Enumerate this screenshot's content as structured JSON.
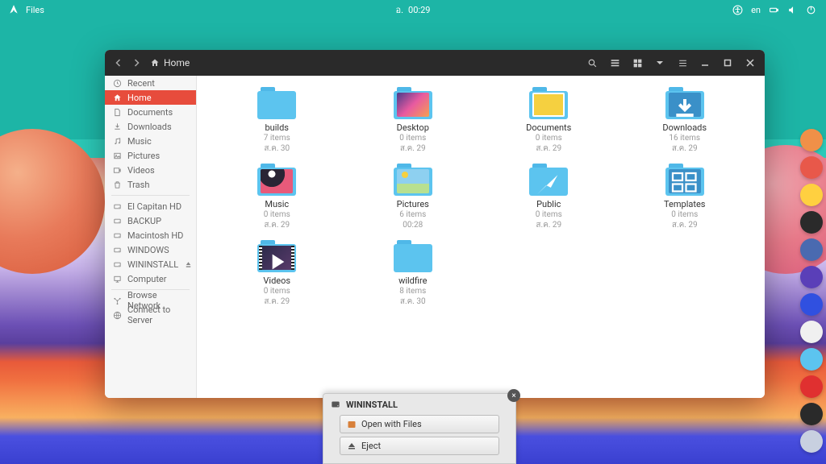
{
  "panel": {
    "app_name": "Files",
    "time_prefix": "อ.",
    "time": "00:29",
    "lang": "en"
  },
  "titlebar": {
    "location_label": "Home"
  },
  "sidebar": {
    "items": [
      {
        "label": "Recent",
        "icon": "clock",
        "active": false
      },
      {
        "label": "Home",
        "icon": "home",
        "active": true
      },
      {
        "label": "Documents",
        "icon": "doc",
        "active": false
      },
      {
        "label": "Downloads",
        "icon": "download",
        "active": false
      },
      {
        "label": "Music",
        "icon": "music",
        "active": false
      },
      {
        "label": "Pictures",
        "icon": "picture",
        "active": false
      },
      {
        "label": "Videos",
        "icon": "video",
        "active": false
      },
      {
        "label": "Trash",
        "icon": "trash",
        "active": false
      }
    ],
    "devices": [
      {
        "label": "El Capitan HD",
        "icon": "hdd"
      },
      {
        "label": "BACKUP",
        "icon": "hdd"
      },
      {
        "label": "Macintosh HD",
        "icon": "hdd"
      },
      {
        "label": "WINDOWS",
        "icon": "hdd"
      },
      {
        "label": "WININSTALL",
        "icon": "hdd",
        "eject": true
      },
      {
        "label": "Computer",
        "icon": "computer"
      }
    ],
    "network": [
      {
        "label": "Browse Network",
        "icon": "net"
      },
      {
        "label": "Connect to Server",
        "icon": "globe"
      }
    ]
  },
  "folders": [
    {
      "name": "builds",
      "items": "7 items",
      "date": "ส.ค. 30",
      "type": "plain"
    },
    {
      "name": "Desktop",
      "items": "0 items",
      "date": "ส.ค. 29",
      "type": "desktop"
    },
    {
      "name": "Documents",
      "items": "0 items",
      "date": "ส.ค. 29",
      "type": "documents"
    },
    {
      "name": "Downloads",
      "items": "16 items",
      "date": "ส.ค. 29",
      "type": "downloads"
    },
    {
      "name": "Music",
      "items": "0 items",
      "date": "ส.ค. 29",
      "type": "music"
    },
    {
      "name": "Pictures",
      "items": "6 items",
      "date": "00:28",
      "type": "pictures"
    },
    {
      "name": "Public",
      "items": "0 items",
      "date": "ส.ค. 29",
      "type": "public"
    },
    {
      "name": "Templates",
      "items": "0 items",
      "date": "ส.ค. 29",
      "type": "templates"
    },
    {
      "name": "Videos",
      "items": "0 items",
      "date": "ส.ค. 29",
      "type": "videos"
    },
    {
      "name": "wildfire",
      "items": "8 items",
      "date": "ส.ค. 30",
      "type": "plain"
    }
  ],
  "dock": {
    "colors": [
      "#f09048",
      "#e8584a",
      "#ffd040",
      "#2a2a2a",
      "#4a6ab0",
      "#5a3fb8",
      "#3050e0",
      "#f0f0f0",
      "#5cc4ef",
      "#e03030",
      "#2a2a2a",
      "#c8d0e0"
    ]
  },
  "notif": {
    "title": "WININSTALL",
    "open_label": "Open with Files",
    "eject_label": "Eject"
  }
}
